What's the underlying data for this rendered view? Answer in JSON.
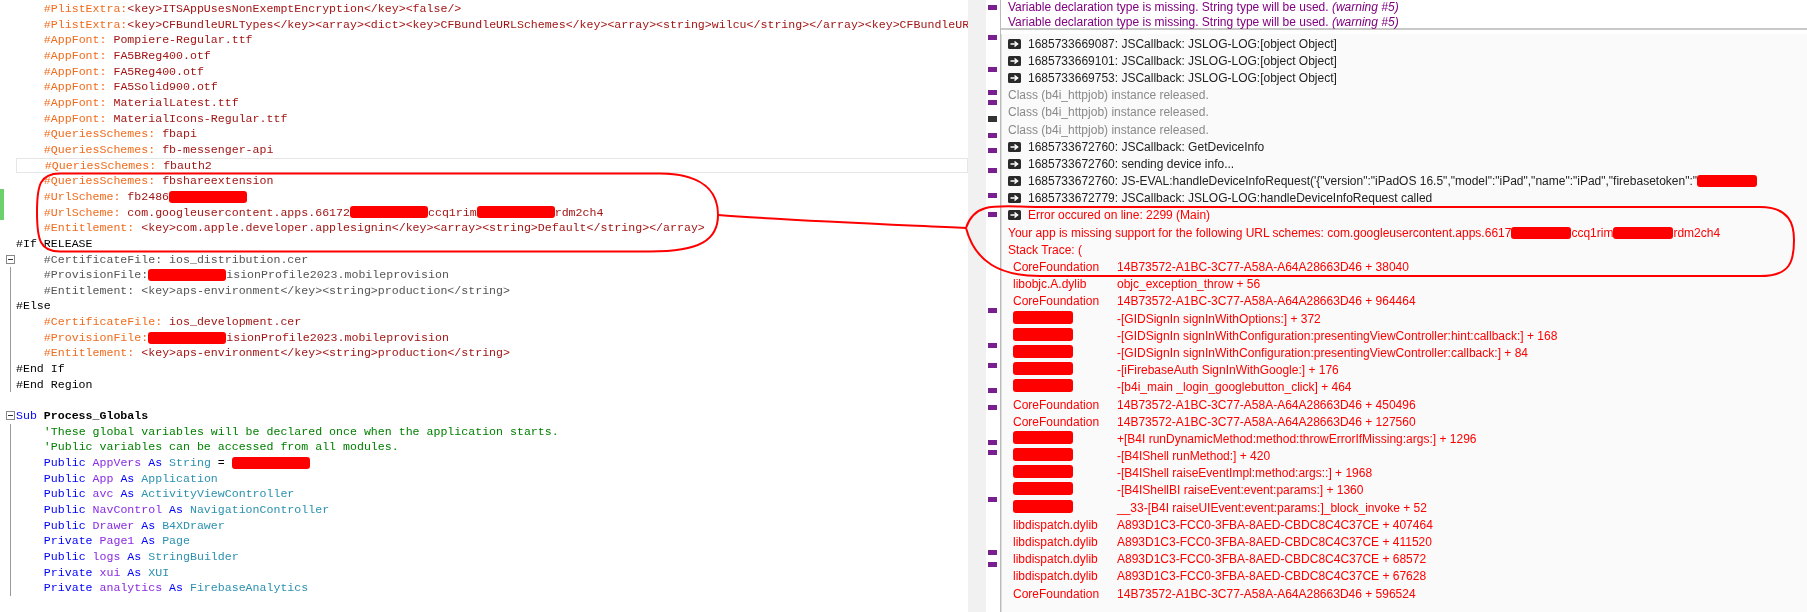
{
  "editor": {
    "lines": [
      {
        "kind": "code",
        "segments": [
          {
            "kind": "directive",
            "text": "    #PlistExtra:"
          },
          {
            "kind": "value",
            "text": "<key>ITSAppUsesNonExemptEncryption</key><false/>"
          }
        ]
      },
      {
        "kind": "code",
        "segments": [
          {
            "kind": "directive",
            "text": "    #PlistExtra:"
          },
          {
            "kind": "value",
            "text": "<key>CFBundleURLTypes</key><array><dict><key>CFBundleURLSchemes</key><array><string>wilcu</string></array><key>CFBundleUR"
          }
        ]
      },
      {
        "kind": "code",
        "segments": [
          {
            "kind": "directive",
            "text": "    #AppFont:"
          },
          {
            "kind": "value",
            "text": " Pompiere-Regular.ttf"
          }
        ]
      },
      {
        "kind": "code",
        "segments": [
          {
            "kind": "directive",
            "text": "    #AppFont:"
          },
          {
            "kind": "value",
            "text": " FA5BReg400.otf"
          }
        ]
      },
      {
        "kind": "code",
        "segments": [
          {
            "kind": "directive",
            "text": "    #AppFont:"
          },
          {
            "kind": "value",
            "text": " FA5Reg400.otf"
          }
        ]
      },
      {
        "kind": "code",
        "segments": [
          {
            "kind": "directive",
            "text": "    #AppFont:"
          },
          {
            "kind": "value",
            "text": " FA5Solid900.otf"
          }
        ]
      },
      {
        "kind": "code",
        "segments": [
          {
            "kind": "directive",
            "text": "    #AppFont:"
          },
          {
            "kind": "value",
            "text": " MaterialLatest.ttf"
          }
        ]
      },
      {
        "kind": "code",
        "segments": [
          {
            "kind": "directive",
            "text": "    #AppFont:"
          },
          {
            "kind": "value",
            "text": " MaterialIcons-Regular.ttf"
          }
        ]
      },
      {
        "kind": "code",
        "segments": [
          {
            "kind": "directive",
            "text": "    #QueriesSchemes:"
          },
          {
            "kind": "value",
            "text": " fbapi"
          }
        ]
      },
      {
        "kind": "code",
        "segments": [
          {
            "kind": "directive",
            "text": "    #QueriesSchemes:"
          },
          {
            "kind": "value",
            "text": " fb-messenger-api"
          }
        ]
      },
      {
        "kind": "code",
        "current": true,
        "segments": [
          {
            "kind": "directive",
            "text": "    #QueriesSchemes:"
          },
          {
            "kind": "value",
            "text": " fbauth2"
          }
        ]
      },
      {
        "kind": "code",
        "segments": [
          {
            "kind": "directive",
            "text": "    #QueriesSchemes:"
          },
          {
            "kind": "value",
            "text": " fbshareextension"
          }
        ]
      },
      {
        "kind": "code",
        "gutter": {
          "kind": "changed"
        },
        "segments": [
          {
            "kind": "directive",
            "text": "    #UrlScheme:"
          },
          {
            "kind": "value",
            "text": " fb2486"
          },
          {
            "kind": "redaction"
          }
        ]
      },
      {
        "kind": "code",
        "gutter": {
          "kind": "changed"
        },
        "segments": [
          {
            "kind": "directive",
            "text": "    #UrlScheme:"
          },
          {
            "kind": "value",
            "text": " com.googleusercontent.apps.66172"
          },
          {
            "kind": "redaction"
          },
          {
            "kind": "value",
            "text": "ccq1rim"
          },
          {
            "kind": "redaction"
          },
          {
            "kind": "value",
            "text": "rdm2ch4"
          }
        ]
      },
      {
        "kind": "code",
        "segments": [
          {
            "kind": "directive",
            "text": "    #Entitlement:"
          },
          {
            "kind": "value",
            "text": " <key>com.apple.developer.applesignin</key><array><string>Default</string></array>"
          }
        ]
      },
      {
        "kind": "code",
        "segments": [
          {
            "kind": "plain",
            "text": "#If RELEASE"
          }
        ]
      },
      {
        "kind": "code",
        "gutter": {
          "kind": "fold"
        },
        "segments": [
          {
            "kind": "inactive",
            "text": "    #CertificateFile: ios_distribution.cer"
          }
        ]
      },
      {
        "kind": "code",
        "gutter": {
          "kind": "line"
        },
        "segments": [
          {
            "kind": "inactive",
            "text": "    #ProvisionFile:"
          },
          {
            "kind": "redaction"
          },
          {
            "kind": "inactive",
            "text": "isionProfile2023.mobileprovision"
          }
        ]
      },
      {
        "kind": "code",
        "gutter": {
          "kind": "line"
        },
        "segments": [
          {
            "kind": "inactive",
            "text": "    #Entitlement: <key>aps-environment</key><string>production</string>"
          }
        ]
      },
      {
        "kind": "code",
        "gutter": {
          "kind": "line"
        },
        "segments": [
          {
            "kind": "plain",
            "text": "#Else"
          }
        ]
      },
      {
        "kind": "code",
        "gutter": {
          "kind": "line"
        },
        "segments": [
          {
            "kind": "directive",
            "text": "    #CertificateFile:"
          },
          {
            "kind": "value",
            "text": " ios_development.cer"
          }
        ]
      },
      {
        "kind": "code",
        "gutter": {
          "kind": "line"
        },
        "segments": [
          {
            "kind": "directive",
            "text": "    #ProvisionFile:"
          },
          {
            "kind": "redaction"
          },
          {
            "kind": "value",
            "text": "isionProfile2023.mobileprovision"
          }
        ]
      },
      {
        "kind": "code",
        "gutter": {
          "kind": "line"
        },
        "segments": [
          {
            "kind": "directive",
            "text": "    #Entitlement:"
          },
          {
            "kind": "value",
            "text": " <key>aps-environment</key><string>production</string>"
          }
        ]
      },
      {
        "kind": "code",
        "gutter": {
          "kind": "line"
        },
        "segments": [
          {
            "kind": "plain",
            "text": "#End If"
          }
        ]
      },
      {
        "kind": "code",
        "gutter": {
          "kind": "line"
        },
        "segments": [
          {
            "kind": "plain",
            "text": "#End Region"
          }
        ]
      },
      {
        "kind": "blank"
      },
      {
        "kind": "code",
        "gutter": {
          "kind": "fold"
        },
        "segments": [
          {
            "kind": "keyword",
            "text": "Sub"
          },
          {
            "kind": "name",
            "text": " Process_Globals"
          }
        ]
      },
      {
        "kind": "code",
        "gutter": {
          "kind": "line"
        },
        "segments": [
          {
            "kind": "comment",
            "text": "    'These global variables will be declared once when the application starts."
          }
        ]
      },
      {
        "kind": "code",
        "gutter": {
          "kind": "line"
        },
        "segments": [
          {
            "kind": "comment",
            "text": "    'Public variables can be accessed from all modules."
          }
        ]
      },
      {
        "kind": "code",
        "gutter": {
          "kind": "line"
        },
        "segments": [
          {
            "kind": "keyword",
            "text": "    Public"
          },
          {
            "kind": "ident",
            "text": " AppVers"
          },
          {
            "kind": "keyword",
            "text": " As"
          },
          {
            "kind": "type",
            "text": " String"
          },
          {
            "kind": "plain",
            "text": " = "
          },
          {
            "kind": "redaction"
          }
        ]
      },
      {
        "kind": "code",
        "gutter": {
          "kind": "line"
        },
        "segments": [
          {
            "kind": "keyword",
            "text": "    Public"
          },
          {
            "kind": "ident",
            "text": " App"
          },
          {
            "kind": "keyword",
            "text": " As"
          },
          {
            "kind": "type",
            "text": " Application"
          }
        ]
      },
      {
        "kind": "code",
        "gutter": {
          "kind": "line"
        },
        "segments": [
          {
            "kind": "keyword",
            "text": "    Public"
          },
          {
            "kind": "ident",
            "text": " avc"
          },
          {
            "kind": "keyword",
            "text": " As"
          },
          {
            "kind": "type",
            "text": " ActivityViewController"
          }
        ]
      },
      {
        "kind": "code",
        "gutter": {
          "kind": "line"
        },
        "segments": [
          {
            "kind": "keyword",
            "text": "    Public"
          },
          {
            "kind": "ident",
            "text": " NavControl"
          },
          {
            "kind": "keyword",
            "text": " As"
          },
          {
            "kind": "type",
            "text": " NavigationController"
          }
        ]
      },
      {
        "kind": "code",
        "gutter": {
          "kind": "line"
        },
        "segments": [
          {
            "kind": "keyword",
            "text": "    Public"
          },
          {
            "kind": "ident",
            "text": " Drawer"
          },
          {
            "kind": "keyword",
            "text": " As"
          },
          {
            "kind": "type",
            "text": " B4XDrawer"
          }
        ]
      },
      {
        "kind": "code",
        "gutter": {
          "kind": "line"
        },
        "segments": [
          {
            "kind": "keyword",
            "text": "    Private"
          },
          {
            "kind": "ident",
            "text": " Page1"
          },
          {
            "kind": "keyword",
            "text": " As"
          },
          {
            "kind": "type",
            "text": " Page"
          }
        ]
      },
      {
        "kind": "code",
        "gutter": {
          "kind": "line"
        },
        "segments": [
          {
            "kind": "keyword",
            "text": "    Public"
          },
          {
            "kind": "ident",
            "text": " logs"
          },
          {
            "kind": "keyword",
            "text": " As"
          },
          {
            "kind": "type",
            "text": " StringBuilder"
          }
        ]
      },
      {
        "kind": "code",
        "gutter": {
          "kind": "line"
        },
        "segments": [
          {
            "kind": "keyword",
            "text": "    Private"
          },
          {
            "kind": "ident",
            "text": " xui"
          },
          {
            "kind": "keyword",
            "text": " As"
          },
          {
            "kind": "type",
            "text": " XUI"
          }
        ]
      },
      {
        "kind": "code",
        "gutter": {
          "kind": "line"
        },
        "segments": [
          {
            "kind": "keyword",
            "text": "    Private"
          },
          {
            "kind": "ident",
            "text": " analytics"
          },
          {
            "kind": "keyword",
            "text": " As"
          },
          {
            "kind": "type",
            "text": " FirebaseAnalytics"
          }
        ]
      }
    ]
  },
  "warnings": [
    "Variable declaration type is missing. String type will be used. *(warning #5)*",
    "Variable declaration type is missing. String type will be used. *(warning #5)*"
  ],
  "log": [
    {
      "kind": "arrow",
      "parts": [
        {
          "text": "1685733669087: JSCallback: JSLOG-LOG:[object Object]"
        }
      ]
    },
    {
      "kind": "arrow",
      "parts": [
        {
          "text": "1685733669101: JSCallback: JSLOG-LOG:[object Object]"
        }
      ]
    },
    {
      "kind": "arrow",
      "parts": [
        {
          "text": "1685733669753: JSCallback: JSLOG-LOG:[object Object]"
        }
      ]
    },
    {
      "kind": "info",
      "parts": [
        {
          "text": "Class (b4i_httpjob) instance released."
        }
      ]
    },
    {
      "kind": "info",
      "parts": [
        {
          "text": "Class (b4i_httpjob) instance released."
        }
      ]
    },
    {
      "kind": "info",
      "parts": [
        {
          "text": "Class (b4i_httpjob) instance released."
        }
      ]
    },
    {
      "kind": "arrow",
      "parts": [
        {
          "text": "1685733672760: JSCallback: GetDeviceInfo"
        }
      ]
    },
    {
      "kind": "arrow",
      "parts": [
        {
          "text": "1685733672760: sending device info..."
        }
      ]
    },
    {
      "kind": "arrow",
      "parts": [
        {
          "text": "1685733672760: JS-EVAL:handleDeviceInfoRequest('{\"version\":\"iPadOS 16.5\",\"model\":\"iPad\",\"name\":\"iPad\",\"firebasetoken\":\""
        },
        {
          "kind": "redaction"
        }
      ]
    },
    {
      "kind": "arrow",
      "parts": [
        {
          "text": "1685733672779: JSCallback: JSLOG-LOG:handleDeviceInfoRequest called"
        }
      ]
    },
    {
      "kind": "error",
      "parts": [
        {
          "text": "Error occured on line: 2299 (Main)"
        }
      ]
    },
    {
      "kind": "message",
      "parts": [
        {
          "text": "Your app is missing support for the following URL schemes: com.googleusercontent.apps.6617"
        },
        {
          "kind": "redaction"
        },
        {
          "text": "ccq1rim"
        },
        {
          "kind": "redaction"
        },
        {
          "text": "rdm2ch4"
        }
      ]
    },
    {
      "kind": "message",
      "parts": [
        {
          "text": "Stack Trace: ("
        }
      ]
    },
    {
      "kind": "trace",
      "parts": [
        {
          "text": "CoreFoundation"
        },
        {
          "text": "14B73572-A1BC-3C77-A58A-A64A28663D46 + 38040"
        }
      ]
    },
    {
      "kind": "trace",
      "parts": [
        {
          "text": "libobjc.A.dylib"
        },
        {
          "text": "objc_exception_throw + 56"
        }
      ]
    },
    {
      "kind": "trace",
      "parts": [
        {
          "text": "CoreFoundation"
        },
        {
          "text": "14B73572-A1BC-3C77-A58A-A64A28663D46 + 964464"
        }
      ]
    },
    {
      "kind": "trace",
      "parts": [
        {
          "kind": "redaction"
        },
        {
          "text": "-[GIDSignIn signInWithOptions:] + 372"
        }
      ]
    },
    {
      "kind": "trace",
      "parts": [
        {
          "kind": "redaction"
        },
        {
          "text": "-[GIDSignIn signInWithConfiguration:presentingViewController:hint:callback:] + 168"
        }
      ]
    },
    {
      "kind": "trace",
      "parts": [
        {
          "kind": "redaction"
        },
        {
          "text": "-[GIDSignIn signInWithConfiguration:presentingViewController:callback:] + 84"
        }
      ]
    },
    {
      "kind": "trace",
      "parts": [
        {
          "kind": "redaction"
        },
        {
          "text": "-[iFirebaseAuth SignInWithGoogle:] + 176"
        }
      ]
    },
    {
      "kind": "trace",
      "parts": [
        {
          "kind": "redaction"
        },
        {
          "text": "-[b4i_main _login_googlebutton_click] + 464"
        }
      ]
    },
    {
      "kind": "trace",
      "parts": [
        {
          "text": "CoreFoundation"
        },
        {
          "text": "14B73572-A1BC-3C77-A58A-A64A28663D46 + 450496"
        }
      ]
    },
    {
      "kind": "trace",
      "parts": [
        {
          "text": "CoreFoundation"
        },
        {
          "text": "14B73572-A1BC-3C77-A58A-A64A28663D46 + 127560"
        }
      ]
    },
    {
      "kind": "trace",
      "parts": [
        {
          "kind": "redaction"
        },
        {
          "text": "+[B4I runDynamicMethod:method:throwErrorIfMissing:args:] + 1296"
        }
      ]
    },
    {
      "kind": "trace",
      "parts": [
        {
          "kind": "redaction"
        },
        {
          "text": "-[B4IShell runMethod:] + 420"
        }
      ]
    },
    {
      "kind": "trace",
      "parts": [
        {
          "kind": "redaction"
        },
        {
          "text": "-[B4IShell raiseEventImpl:method:args::] + 1968"
        }
      ]
    },
    {
      "kind": "trace",
      "parts": [
        {
          "kind": "redaction"
        },
        {
          "text": "-[B4IShellBI raiseEvent:event:params:] + 1360"
        }
      ]
    },
    {
      "kind": "trace",
      "parts": [
        {
          "kind": "redaction"
        },
        {
          "text": "__33-[B4I raiseUIEvent:event:params:]_block_invoke + 52"
        }
      ]
    },
    {
      "kind": "trace",
      "parts": [
        {
          "text": "libdispatch.dylib"
        },
        {
          "text": "A893D1C3-FCC0-3FBA-8AED-CBDC8C4C37CE + 407464"
        }
      ]
    },
    {
      "kind": "trace",
      "parts": [
        {
          "text": "libdispatch.dylib"
        },
        {
          "text": "A893D1C3-FCC0-3FBA-8AED-CBDC8C4C37CE + 411520"
        }
      ]
    },
    {
      "kind": "trace",
      "parts": [
        {
          "text": "libdispatch.dylib"
        },
        {
          "text": "A893D1C3-FCC0-3FBA-8AED-CBDC8C4C37CE + 68572"
        }
      ]
    },
    {
      "kind": "trace",
      "parts": [
        {
          "text": "libdispatch.dylib"
        },
        {
          "text": "A893D1C3-FCC0-3FBA-8AED-CBDC8C4C37CE + 67628"
        }
      ]
    },
    {
      "kind": "trace",
      "parts": [
        {
          "text": "CoreFoundation"
        },
        {
          "text": "14B73572-A1BC-3C77-A58A-A64A28663D46 + 596524"
        }
      ]
    }
  ]
}
